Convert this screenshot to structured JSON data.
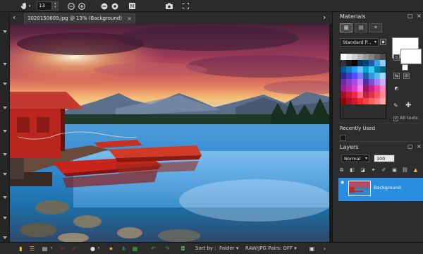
{
  "toolbar": {
    "zoom_value": "13",
    "buttons": [
      "pan",
      "zoom-out",
      "zoom-in",
      "zoom-out-alt",
      "zoom-in-alt",
      "metadata",
      "camera",
      "fullscreen"
    ]
  },
  "document": {
    "tab_title": "3020150609.jpg @  13% (Background)",
    "tab_close": "×",
    "nav_prev": "‹",
    "nav_next": "›"
  },
  "materials": {
    "title": "Materials",
    "palette_dropdown": "Standard P...",
    "all_tools_label": "All tools",
    "foreground_color": "#ffffff",
    "background_color": "#ffffff",
    "swatch_colors": [
      "#ffffff",
      "#e6e6e6",
      "#cccccc",
      "#b3b3b3",
      "#999999",
      "#808080",
      "#666666",
      "#4d4d4d",
      "#333333",
      "#1a1a1a",
      "#000000",
      "#003366",
      "#00457a",
      "#1a60a8",
      "#3da0e6",
      "#8cd0ff",
      "#005c99",
      "#0a7ecc",
      "#1fa0ff",
      "#66c2ff",
      "#00a3cc",
      "#33ccee",
      "#0088aa",
      "#006680",
      "#2a2a8c",
      "#3d3dcc",
      "#5050ff",
      "#7a7aff",
      "#1b5fa6",
      "#3399dd",
      "#55bbee",
      "#99ddff",
      "#6a2ea0",
      "#8a3ccc",
      "#a64de6",
      "#c880ff",
      "#5030a0",
      "#7a50d0",
      "#a080ff",
      "#c8b0ff",
      "#9b1f8a",
      "#c02aa8",
      "#e040c8",
      "#ff80e0",
      "#a01060",
      "#cc2080",
      "#ee4499",
      "#ff88bb",
      "#a0102a",
      "#cc1a3a",
      "#ee2a4a",
      "#ff6680",
      "#c02040",
      "#e03050",
      "#ff5060",
      "#ff8899",
      "#8a0a10",
      "#b01020",
      "#d01828",
      "#ee2a30",
      "#ff4040",
      "#ff6060",
      "#ff8080",
      "#ffaaaa"
    ],
    "recently_used_label": "Recently Used"
  },
  "layers": {
    "title": "Layers",
    "blend_mode": "Normal",
    "opacity": "100",
    "items": [
      {
        "name": "Background",
        "selected": true
      }
    ]
  },
  "bottombar": {
    "sort_label": "Sort by :",
    "sort_value": "Folder",
    "raw_jpg_label": "RAW/JPG Pairs: OFF"
  }
}
